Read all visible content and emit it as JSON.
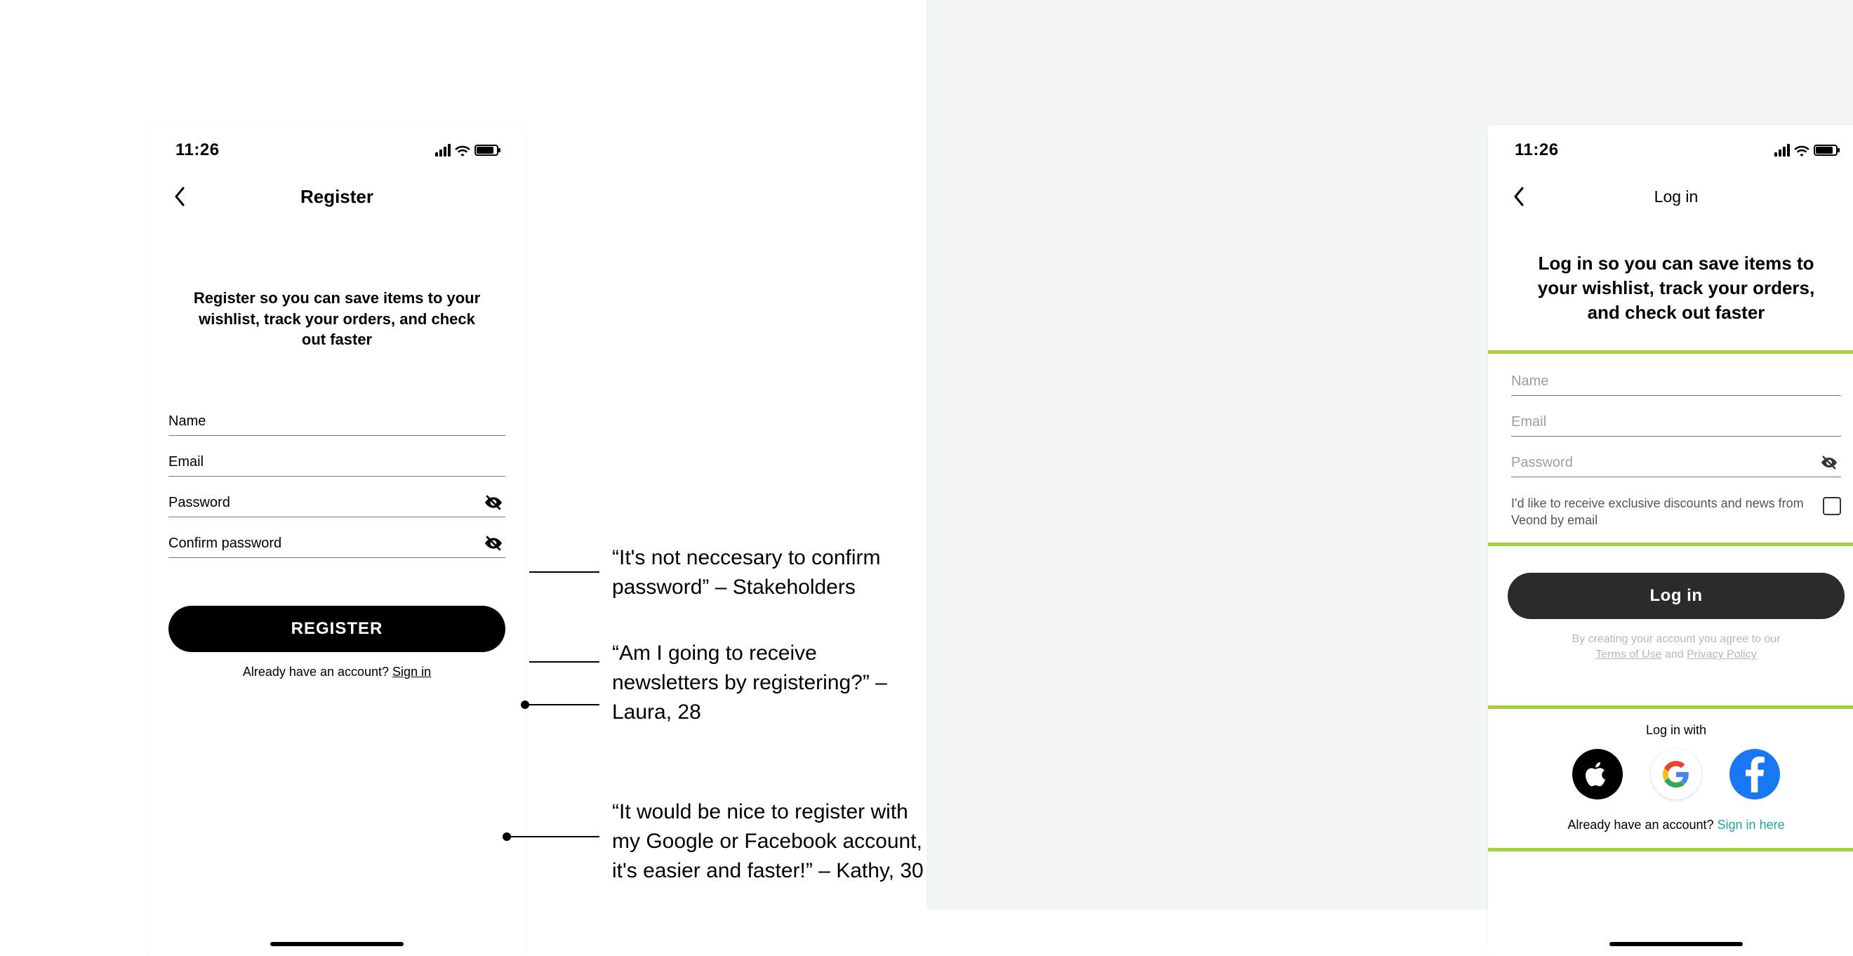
{
  "status_time": "11:26",
  "left": {
    "title": "Register",
    "intro": "Register so you can save items to your wishlist, track your orders, and check out faster",
    "fields": {
      "name": "Name",
      "email": "Email",
      "password": "Password",
      "confirm_password": "Confirm password"
    },
    "button": "REGISTER",
    "already_prefix": "Already have an account? ",
    "already_link": "Sign in"
  },
  "right": {
    "title": "Log in",
    "intro": "Log in so you can save items to your wishlist, track your orders, and check out faster",
    "fields": {
      "name": "Name",
      "email": "Email",
      "password": "Password"
    },
    "newsletter": "I'd like to receive exclusive discounts and news from Veond by email",
    "button": "Log in",
    "legal_prefix": "By creating your account you agree to our",
    "legal_terms": "Terms of Use",
    "legal_and": " and ",
    "legal_privacy": "Privacy Policy",
    "login_with": "Log in with",
    "already_prefix": "Already have an account? ",
    "already_link": "Sign in here"
  },
  "annotations": {
    "a1": "“It's not neccesary to confirm password” – Stakeholders",
    "a2": "“Am I going to receive newsletters by registering?” – Laura, 28",
    "a3": "“It would be nice to register with my Google or Facebook account, it's easier and faster!” – Kathy, 30"
  },
  "icons": {
    "back": "back-icon",
    "eye_off": "eye-off-icon",
    "signal": "signal-icon",
    "wifi": "wifi-icon",
    "battery": "battery-icon",
    "apple": "apple-icon",
    "google": "google-icon",
    "facebook": "facebook-icon",
    "checkbox": "checkbox-icon"
  }
}
